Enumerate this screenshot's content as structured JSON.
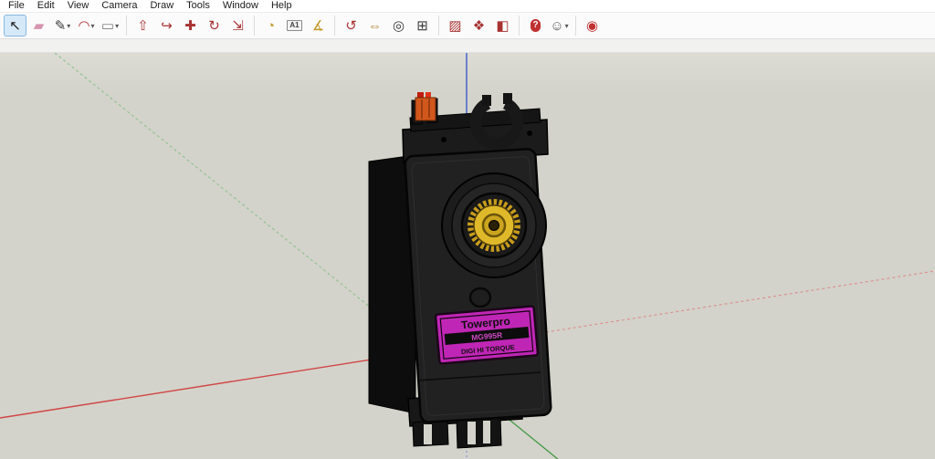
{
  "menu": {
    "items": [
      "File",
      "Edit",
      "View",
      "Camera",
      "Draw",
      "Tools",
      "Window",
      "Help"
    ]
  },
  "toolbar": {
    "items": [
      {
        "name": "select-tool",
        "glyph": "↖",
        "color": "#1a1a1a",
        "active": true
      },
      {
        "name": "eraser-tool",
        "glyph": "▰",
        "color": "#d694ae"
      },
      {
        "name": "line-tool",
        "glyph": "✎",
        "color": "#3a3a3a",
        "dropdown": true
      },
      {
        "name": "arc-tool",
        "glyph": "◠",
        "color": "#a83232",
        "dropdown": true
      },
      {
        "name": "rectangle-tool",
        "glyph": "▭",
        "color": "#7d7d7d",
        "dropdown": true
      },
      {
        "separator": true
      },
      {
        "name": "pushpull-tool",
        "glyph": "⇧",
        "color": "#a83232"
      },
      {
        "name": "followme-tool",
        "glyph": "↪",
        "color": "#a83232"
      },
      {
        "name": "move-tool",
        "glyph": "✚",
        "color": "#a83232"
      },
      {
        "name": "rotate-tool",
        "glyph": "↻",
        "color": "#a83232"
      },
      {
        "name": "scale-tool",
        "glyph": "⇲",
        "color": "#a83232"
      },
      {
        "separator": true
      },
      {
        "name": "tape-measure-tool",
        "glyph": "◔",
        "color": "#c2992a"
      },
      {
        "name": "dimension-tool",
        "glyph": "A1",
        "color": "#444444",
        "boxed": true
      },
      {
        "name": "protractor-tool",
        "glyph": "∡",
        "color": "#c2992a"
      },
      {
        "separator": true
      },
      {
        "name": "orbit-tool",
        "glyph": "↺",
        "color": "#a83232"
      },
      {
        "name": "pan-tool",
        "glyph": "⇔",
        "color": "#b5893a"
      },
      {
        "name": "zoom-tool",
        "glyph": "◎",
        "color": "#3a3a3a"
      },
      {
        "name": "zoom-extents-tool",
        "glyph": "⊞",
        "color": "#3a3a3a"
      },
      {
        "separator": true
      },
      {
        "name": "paint-bucket-tool",
        "glyph": "▨",
        "color": "#a83232"
      },
      {
        "name": "components-tool",
        "glyph": "❖",
        "color": "#a83232"
      },
      {
        "name": "styles-tool",
        "glyph": "◧",
        "color": "#a83232"
      },
      {
        "separator": true
      },
      {
        "name": "warehouse-tool",
        "glyph": "?",
        "color": "#ffffff",
        "badge": true
      },
      {
        "name": "avatar-menu",
        "glyph": "☺",
        "color": "#5a5a5a",
        "dropdown": true
      },
      {
        "separator": true
      },
      {
        "name": "extensions-tool",
        "glyph": "◉",
        "color": "#c03030"
      }
    ]
  },
  "viewport": {
    "axes": {
      "red": "#d24545",
      "red_dashed": "#dd9090",
      "green": "#4f9d4f",
      "green_dashed": "#93c293",
      "blue": "#3b5bc9",
      "blue_dashed": "#8a97d6"
    },
    "model": {
      "label": {
        "brand": "Towerpro",
        "model_number": "MG995R",
        "subtitle": "DIGI HI TORQUE"
      },
      "colors": {
        "body": "#212121",
        "side": "#0d0d0d",
        "label_bg": "#c026b6",
        "label_band": "#0c0c0c",
        "label_text": "#101010",
        "band_text": "#cf49c4",
        "gear_gold": "#dfb92a",
        "gear_dark": "#caa41e",
        "connector_orange": "#d2571c",
        "connector_red": "#c11d0e",
        "background": "#d3d3cb"
      }
    }
  }
}
